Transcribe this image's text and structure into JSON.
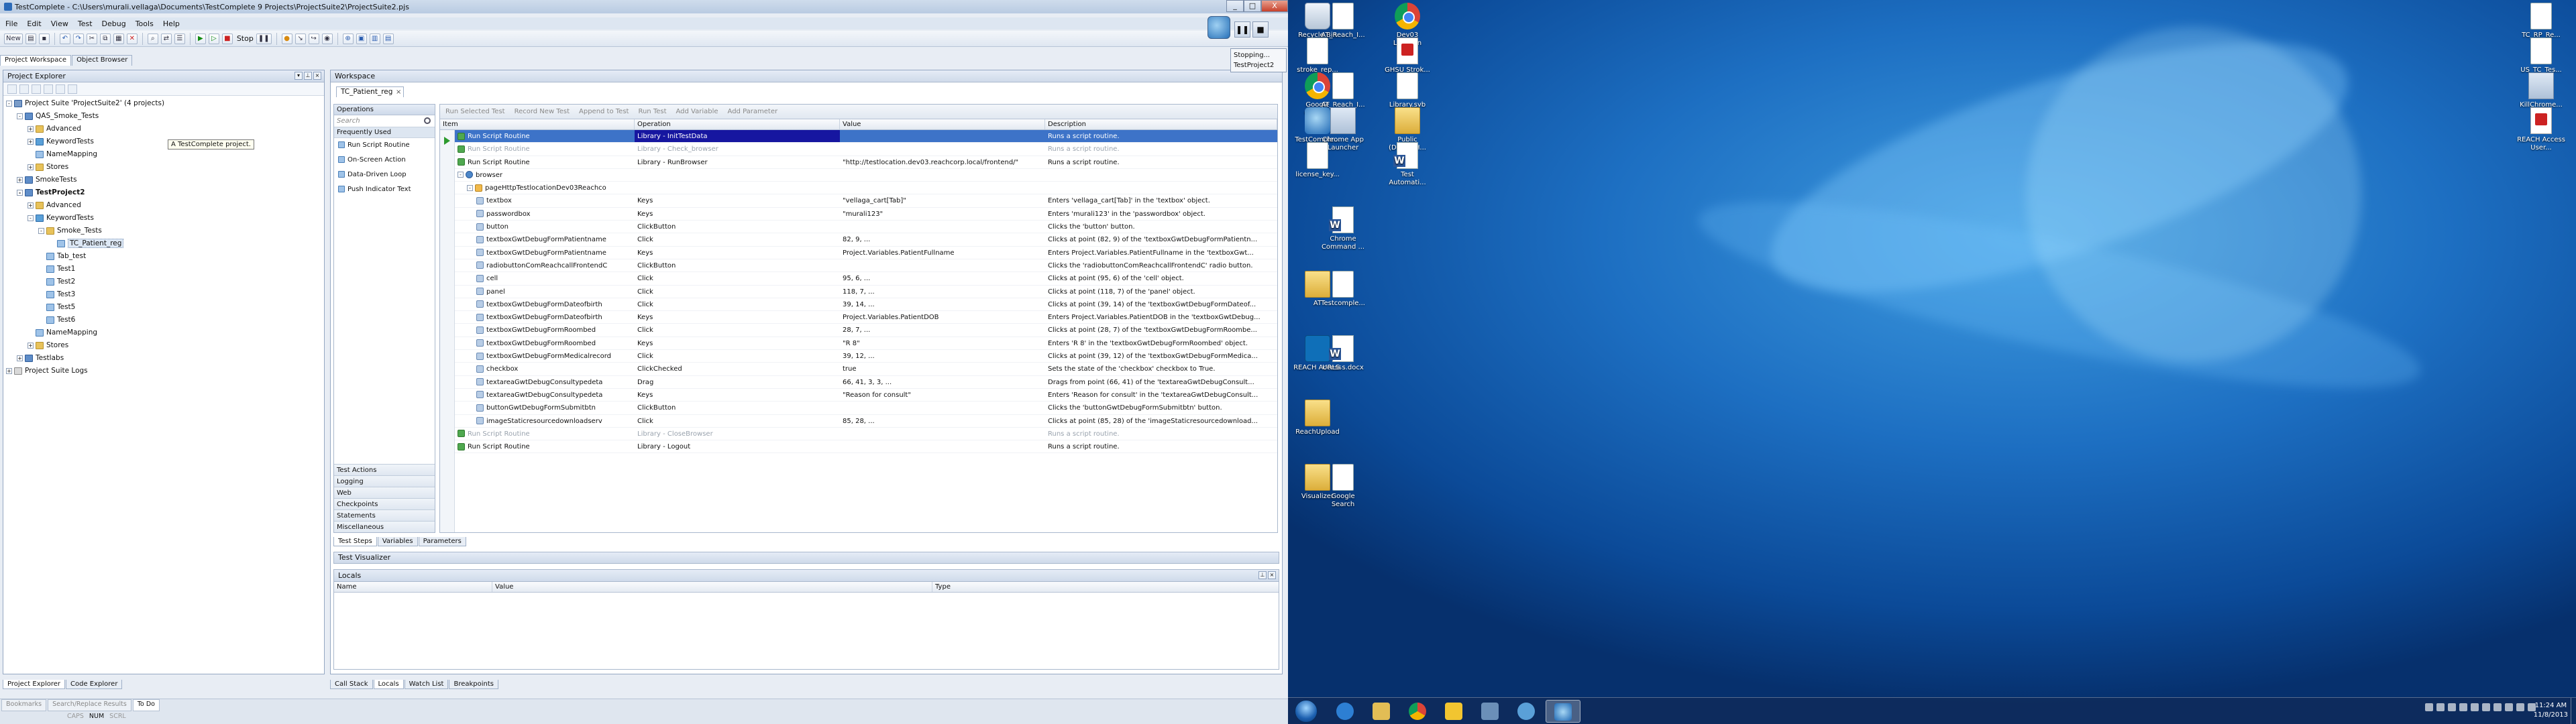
{
  "window": {
    "title": "TestComplete - C:\\Users\\murali.vellaga\\Documents\\TestComplete 9 Projects\\ProjectSuite2\\ProjectSuite2.pjs",
    "controls": [
      "_",
      "□",
      "X"
    ]
  },
  "menu": [
    "File",
    "Edit",
    "View",
    "Test",
    "Debug",
    "Tools",
    "Help"
  ],
  "toolbar": {
    "new_label": "New",
    "stop_label": "Stop"
  },
  "top_tabs": [
    "Project Workspace",
    "Object Browser"
  ],
  "project_explorer": {
    "title": "Project Explorer",
    "tooltip": "A TestComplete project.",
    "tree": [
      {
        "label": "Project Suite 'ProjectSuite2' (4 projects)",
        "level": 0,
        "exp": "-",
        "icon": "suite"
      },
      {
        "label": "QAS_Smoke_Tests",
        "level": 1,
        "exp": "-",
        "icon": "proj"
      },
      {
        "label": "Advanced",
        "level": 2,
        "exp": "+",
        "icon": "folder"
      },
      {
        "label": "KeywordTests",
        "level": 2,
        "exp": "+",
        "icon": "kw"
      },
      {
        "label": "NameMapping",
        "level": 2,
        "exp": "",
        "icon": "test"
      },
      {
        "label": "Stores",
        "level": 2,
        "exp": "+",
        "icon": "folder"
      },
      {
        "label": "SmokeTests",
        "level": 1,
        "exp": "+",
        "icon": "proj"
      },
      {
        "label": "TestProject2",
        "level": 1,
        "exp": "-",
        "icon": "proj",
        "bold": true
      },
      {
        "label": "Advanced",
        "level": 2,
        "exp": "+",
        "icon": "folder"
      },
      {
        "label": "KeywordTests",
        "level": 2,
        "exp": "-",
        "icon": "kw"
      },
      {
        "label": "Smoke_Tests",
        "level": 3,
        "exp": "-",
        "icon": "folder"
      },
      {
        "label": "TC_Patient_reg",
        "level": 4,
        "exp": "",
        "icon": "test",
        "selected": true
      },
      {
        "label": "Tab_test",
        "level": 3,
        "exp": "",
        "icon": "test"
      },
      {
        "label": "Test1",
        "level": 3,
        "exp": "",
        "icon": "test"
      },
      {
        "label": "Test2",
        "level": 3,
        "exp": "",
        "icon": "test"
      },
      {
        "label": "Test3",
        "level": 3,
        "exp": "",
        "icon": "test"
      },
      {
        "label": "Test5",
        "level": 3,
        "exp": "",
        "icon": "test"
      },
      {
        "label": "Test6",
        "level": 3,
        "exp": "",
        "icon": "test"
      },
      {
        "label": "NameMapping",
        "level": 2,
        "exp": "",
        "icon": "test"
      },
      {
        "label": "Stores",
        "level": 2,
        "exp": "+",
        "icon": "folder"
      },
      {
        "label": "Testlabs",
        "level": 1,
        "exp": "+",
        "icon": "proj"
      },
      {
        "label": "Project Suite Logs",
        "level": 0,
        "exp": "+",
        "icon": "log"
      }
    ],
    "bottom_tabs": [
      "Project Explorer",
      "Code Explorer"
    ]
  },
  "workspace": {
    "title": "Workspace",
    "doc_tab": "TC_Patient_reg",
    "operations": {
      "title": "Operations",
      "search_placeholder": "Search",
      "group": "Frequently Used",
      "items": [
        "Run Script Routine",
        "On-Screen Action",
        "Data-Driven Loop",
        "Push Indicator Text"
      ],
      "categories": [
        "Test Actions",
        "Logging",
        "Web",
        "Checkpoints",
        "Statements",
        "Miscellaneous"
      ]
    },
    "editor_toolbar": [
      "Run Selected Test",
      "Record New Test",
      "Append to Test",
      "Run Test",
      "Add Variable",
      "Add Parameter"
    ],
    "columns": [
      "Item",
      "Operation",
      "Value",
      "Description"
    ],
    "rows": [
      {
        "item": "Run Script Routine",
        "op": "Library - InitTestData",
        "val": "",
        "desc": "Runs a script routine.",
        "lvl": 0,
        "icon": "green",
        "state": "sel"
      },
      {
        "item": "Run Script Routine",
        "op": "Library - Check_browser",
        "val": "",
        "desc": "Runs a script routine.",
        "lvl": 0,
        "icon": "green",
        "state": "dis"
      },
      {
        "item": "Run Script Routine",
        "op": "Library - RunBrowser",
        "val": "\"http://testlocation.dev03.reachcorp.local/frontend/\"",
        "desc": "Runs a script routine.",
        "lvl": 0,
        "icon": "green"
      },
      {
        "item": "browser",
        "op": "",
        "val": "",
        "desc": "",
        "lvl": 0,
        "icon": "globe",
        "exp": "-"
      },
      {
        "item": "pageHttpTestlocationDev03Reachco",
        "op": "",
        "val": "",
        "desc": "",
        "lvl": 1,
        "icon": "page",
        "exp": "-"
      },
      {
        "item": "textbox",
        "op": "Keys",
        "val": "\"vellaga_cart[Tab]\"",
        "desc": "Enters 'vellaga_cart[Tab]' in the 'textbox' object.",
        "lvl": 2,
        "icon": "obj"
      },
      {
        "item": "passwordbox",
        "op": "Keys",
        "val": "\"murali123\"",
        "desc": "Enters 'murali123' in the 'passwordbox' object.",
        "lvl": 2,
        "icon": "obj"
      },
      {
        "item": "button",
        "op": "ClickButton",
        "val": "",
        "desc": "Clicks the 'button' button.",
        "lvl": 2,
        "icon": "obj"
      },
      {
        "item": "textboxGwtDebugFormPatientname",
        "op": "Click",
        "val": "82, 9, ...",
        "desc": "Clicks at point (82, 9) of the 'textboxGwtDebugFormPatientn...",
        "lvl": 2,
        "icon": "obj"
      },
      {
        "item": "textboxGwtDebugFormPatientname",
        "op": "Keys",
        "val": "Project.Variables.PatientFullname",
        "desc": "Enters Project.Variables.PatientFullname in the 'textboxGwt...",
        "lvl": 2,
        "icon": "obj"
      },
      {
        "item": "radiobuttonComReachcallFrontendC",
        "op": "ClickButton",
        "val": "",
        "desc": "Clicks the 'radiobuttonComReachcallFrontendC' radio button.",
        "lvl": 2,
        "icon": "obj"
      },
      {
        "item": "cell",
        "op": "Click",
        "val": "95, 6, ...",
        "desc": "Clicks at point (95, 6) of the 'cell' object.",
        "lvl": 2,
        "icon": "obj"
      },
      {
        "item": "panel",
        "op": "Click",
        "val": "118, 7, ...",
        "desc": "Clicks at point (118, 7) of the 'panel' object.",
        "lvl": 2,
        "icon": "obj"
      },
      {
        "item": "textboxGwtDebugFormDateofbirth",
        "op": "Click",
        "val": "39, 14, ...",
        "desc": "Clicks at point (39, 14) of the 'textboxGwtDebugFormDateof...",
        "lvl": 2,
        "icon": "obj"
      },
      {
        "item": "textboxGwtDebugFormDateofbirth",
        "op": "Keys",
        "val": "Project.Variables.PatientDOB",
        "desc": "Enters Project.Variables.PatientDOB in the 'textboxGwtDebug...",
        "lvl": 2,
        "icon": "obj"
      },
      {
        "item": "textboxGwtDebugFormRoombed",
        "op": "Click",
        "val": "28, 7, ...",
        "desc": "Clicks at point (28, 7) of the 'textboxGwtDebugFormRoombe...",
        "lvl": 2,
        "icon": "obj"
      },
      {
        "item": "textboxGwtDebugFormRoombed",
        "op": "Keys",
        "val": "\"R 8\"",
        "desc": "Enters 'R 8' in the 'textboxGwtDebugFormRoombed' object.",
        "lvl": 2,
        "icon": "obj"
      },
      {
        "item": "textboxGwtDebugFormMedicalrecord",
        "op": "Click",
        "val": "39, 12, ...",
        "desc": "Clicks at point (39, 12) of the 'textboxGwtDebugFormMedica...",
        "lvl": 2,
        "icon": "obj"
      },
      {
        "item": "checkbox",
        "op": "ClickChecked",
        "val": "true",
        "desc": "Sets the state of the 'checkbox' checkbox to True.",
        "lvl": 2,
        "icon": "obj"
      },
      {
        "item": "textareaGwtDebugConsultypedeta",
        "op": "Drag",
        "val": "66, 41, 3, 3, ...",
        "desc": "Drags from point (66, 41) of the 'textareaGwtDebugConsult...",
        "lvl": 2,
        "icon": "obj"
      },
      {
        "item": "textareaGwtDebugConsultypedeta",
        "op": "Keys",
        "val": "\"Reason for consult\"",
        "desc": "Enters 'Reason for consult' in the 'textareaGwtDebugConsult...",
        "lvl": 2,
        "icon": "obj"
      },
      {
        "item": "buttonGwtDebugFormSubmitbtn",
        "op": "ClickButton",
        "val": "",
        "desc": "Clicks the 'buttonGwtDebugFormSubmitbtn' button.",
        "lvl": 2,
        "icon": "obj"
      },
      {
        "item": "imageStaticresourcedownloadserv",
        "op": "Click",
        "val": "85, 28, ...",
        "desc": "Clicks at point (85, 28) of the 'imageStaticresourcedownload...",
        "lvl": 2,
        "icon": "obj"
      },
      {
        "item": "Run Script Routine",
        "op": "Library - CloseBrowser",
        "val": "",
        "desc": "Runs a script routine.",
        "lvl": 0,
        "icon": "green",
        "state": "dis"
      },
      {
        "item": "Run Script Routine",
        "op": "Library - Logout",
        "val": "",
        "desc": "Runs a script routine.",
        "lvl": 0,
        "icon": "green"
      }
    ],
    "bottom_tabs": [
      "Test Steps",
      "Variables",
      "Parameters"
    ],
    "test_visualizer": "Test Visualizer",
    "locals": {
      "title": "Locals",
      "columns": [
        "Name",
        "Value",
        "Type"
      ]
    },
    "debug_tabs": [
      "Call Stack",
      "Locals",
      "Watch List",
      "Breakpoints"
    ]
  },
  "status": {
    "tabs": [
      "Bookmarks",
      "Search/Replace Results",
      "To Do"
    ],
    "indicators": [
      "CAPS",
      "NUM",
      "SCRL"
    ]
  },
  "stopping_popup": {
    "text1": "Stopping...",
    "text2": "TestProject2"
  },
  "desktop": {
    "icons": [
      {
        "label": "Recycle Bin",
        "img": "recycle"
      },
      {
        "label": "AT_Reach_I...",
        "img": "doc"
      },
      {
        "label": "Dev03 Location",
        "img": "chrome"
      },
      {
        "label": "stroke_rep...",
        "img": "doc"
      },
      {
        "label": "GHSU Strok...",
        "img": "pdf"
      },
      {
        "label": "Google Chrome",
        "img": "chrome"
      },
      {
        "label": "AT_Reach_I...",
        "img": "doc"
      },
      {
        "label": "Library.svb",
        "img": "doc"
      },
      {
        "label": "TestComple... 9",
        "img": "tc"
      },
      {
        "label": "Chrome App Launcher",
        "img": "exe"
      },
      {
        "label": "Public (DSMETH...",
        "img": "folder"
      },
      {
        "label": "license_key...",
        "img": "doc"
      },
      {
        "label": "Test Automati...",
        "img": "word"
      },
      {
        "label": "Chrome Command ...",
        "img": "word"
      },
      {
        "label": "AT",
        "img": "folder"
      },
      {
        "label": "Testcomple...",
        "img": "doc"
      },
      {
        "label": "REACH Access",
        "img": "reach"
      },
      {
        "label": "URLS s.docx",
        "img": "word"
      },
      {
        "label": "ReachUpload",
        "img": "folder"
      },
      {
        "label": "Visualizer",
        "img": "folder"
      },
      {
        "label": "Google Search",
        "img": "doc"
      },
      {
        "label": "TC_RP_Re...",
        "img": "doc"
      },
      {
        "label": "US_TC_Tes...",
        "img": "doc"
      },
      {
        "label": "KillChrome...",
        "img": "exe"
      },
      {
        "label": "REACH Access User...",
        "img": "pdf"
      }
    ],
    "clock": {
      "time": "11:24 AM",
      "date": "11/8/2013"
    }
  }
}
